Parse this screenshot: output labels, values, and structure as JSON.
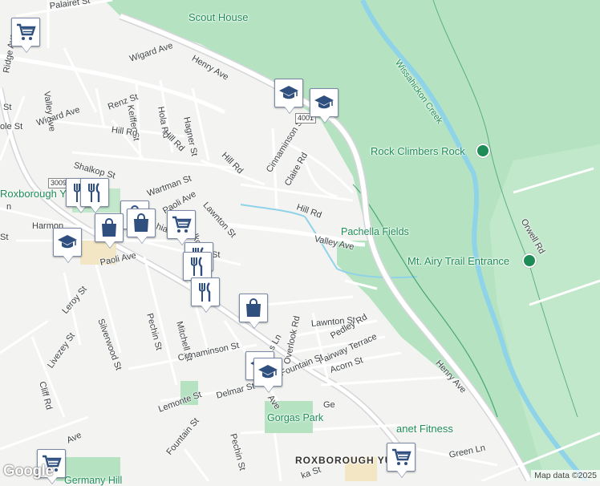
{
  "map": {
    "colors": {
      "land": "#f3f3f1",
      "park": "#b5e3c2",
      "park_light": "#cfeed6",
      "water": "#8fd3e8",
      "road": "#ffffff",
      "road_outline": "#dadada",
      "arterial": "#d9d9df",
      "pin_accent": "#2f4f7f"
    },
    "labels": {
      "scout_house": "Scout House",
      "wissahickon_creek": "Wissahickon Creek",
      "rock_climbers_rock": "Rock Climbers Rock",
      "pachella_fields": "Pachella Fields",
      "mt_airy_trail": "Mt. Airy Trail Entrance",
      "roxborough_ym": "Roxborough YM",
      "gorgas_park": "Gorgas Park",
      "planet_fitness": "anet Fitness",
      "roxborough_manayunk": "ROXBOROUGH    YUNK",
      "germany_hill": "Germany Hill",
      "palairet_st": "Palairet St",
      "ridge_ave": "Ridge Ave",
      "wigard_ave_top": "Wigard Ave",
      "wigard_ave_left": "Wigard Ave",
      "henry_ave_top": "Henry Ave",
      "henry_ave_bottom": "Henry Ave",
      "valley_ave_left": "Valley Ave",
      "valley_ave_mid": "Valley Ave",
      "renz_st": "Renz St",
      "keiffer_st": "Keiffer St",
      "hola_rd": "Hola Rd",
      "hagner_st": "Hagner St",
      "hill_rd_left": "Hill Rd",
      "hill_rd_mid": "Hill Rd",
      "hill_rd_diag": "Hill Rd",
      "hill_rd_right": "Hill Rd",
      "cinnaminson_st_top": "Cinnaminson St",
      "cinnaminson_st_bottom": "Cinnaminson St",
      "claire_rd": "Claire Rd",
      "shalkop_st_left": "Shalkop St",
      "shalkop_st_mid": "Shalkop St",
      "wartman_st": "Wartman St",
      "lawnton_st_mid": "Lawnton St",
      "lawnton_st_bottom": "Lawnton St",
      "paoli_ave_top": "Paoli Ave",
      "paoli_ave_left": "Paoli Ave",
      "harmon": "Harmon",
      "hia": "hia",
      "orwell_rd": "Orwell Rd",
      "leroy_st": "Leroy St",
      "silverwood_st": "Silverwood St",
      "pechin_st_top": "Pechin St",
      "pechin_st_bottom": "Pechin St",
      "mitchell_st": "Mitchell St",
      "livezey_st": "Livezey St",
      "cliff_rd": "Cliff Rd",
      "overlook_rd": "Overlook Rd",
      "pedley_rd": "Pedley Rd",
      "fairway_terrace": "Fairway Terrace",
      "fountain_st_mid": "Fountain St",
      "fountain_st_bottom": "Fountain St",
      "acorn_st": "Acorn St",
      "delmar_st": "Delmar St",
      "lemonte_st": "Lemonte St",
      "green_ln": "Green Ln",
      "ave_bottom_left": "Ave",
      "s_ln": "s Ln",
      "ave_delmar": "Ave",
      "ge": "Ge",
      "ka_st": "ka St",
      "ole_st": "ole St",
      "st_small_1": "St",
      "st_small_2": "St",
      "st_small_3": "St",
      "n_small": "n"
    },
    "shields": {
      "r3009": "3009",
      "r4001": "4001"
    },
    "pins": [
      {
        "icon": "shopping-cart-icon",
        "name": "grocery"
      },
      {
        "icon": "school-icon",
        "name": "school"
      },
      {
        "icon": "school-icon",
        "name": "school"
      },
      {
        "icon": "restaurant-icon",
        "name": "restaurant"
      },
      {
        "icon": "restaurant-icon",
        "name": "restaurant"
      },
      {
        "icon": "shopping-bag-icon",
        "name": "shop"
      },
      {
        "icon": "shopping-bag-icon",
        "name": "shop"
      },
      {
        "icon": "shopping-cart-icon",
        "name": "grocery"
      },
      {
        "icon": "school-icon",
        "name": "school"
      },
      {
        "icon": "restaurant-icon",
        "name": "restaurant"
      },
      {
        "icon": "restaurant-icon",
        "name": "restaurant"
      },
      {
        "icon": "shopping-bag-icon",
        "name": "shop"
      },
      {
        "icon": "school-icon",
        "name": "school"
      },
      {
        "icon": "school-icon",
        "name": "school"
      },
      {
        "icon": "restaurant-icon",
        "name": "restaurant"
      },
      {
        "icon": "shopping-bag-icon",
        "name": "shop"
      },
      {
        "icon": "shopping-cart-icon",
        "name": "grocery"
      },
      {
        "icon": "shopping-cart-icon",
        "name": "grocery"
      }
    ],
    "google_logo": "Google",
    "attribution": "Map data ©2025"
  }
}
